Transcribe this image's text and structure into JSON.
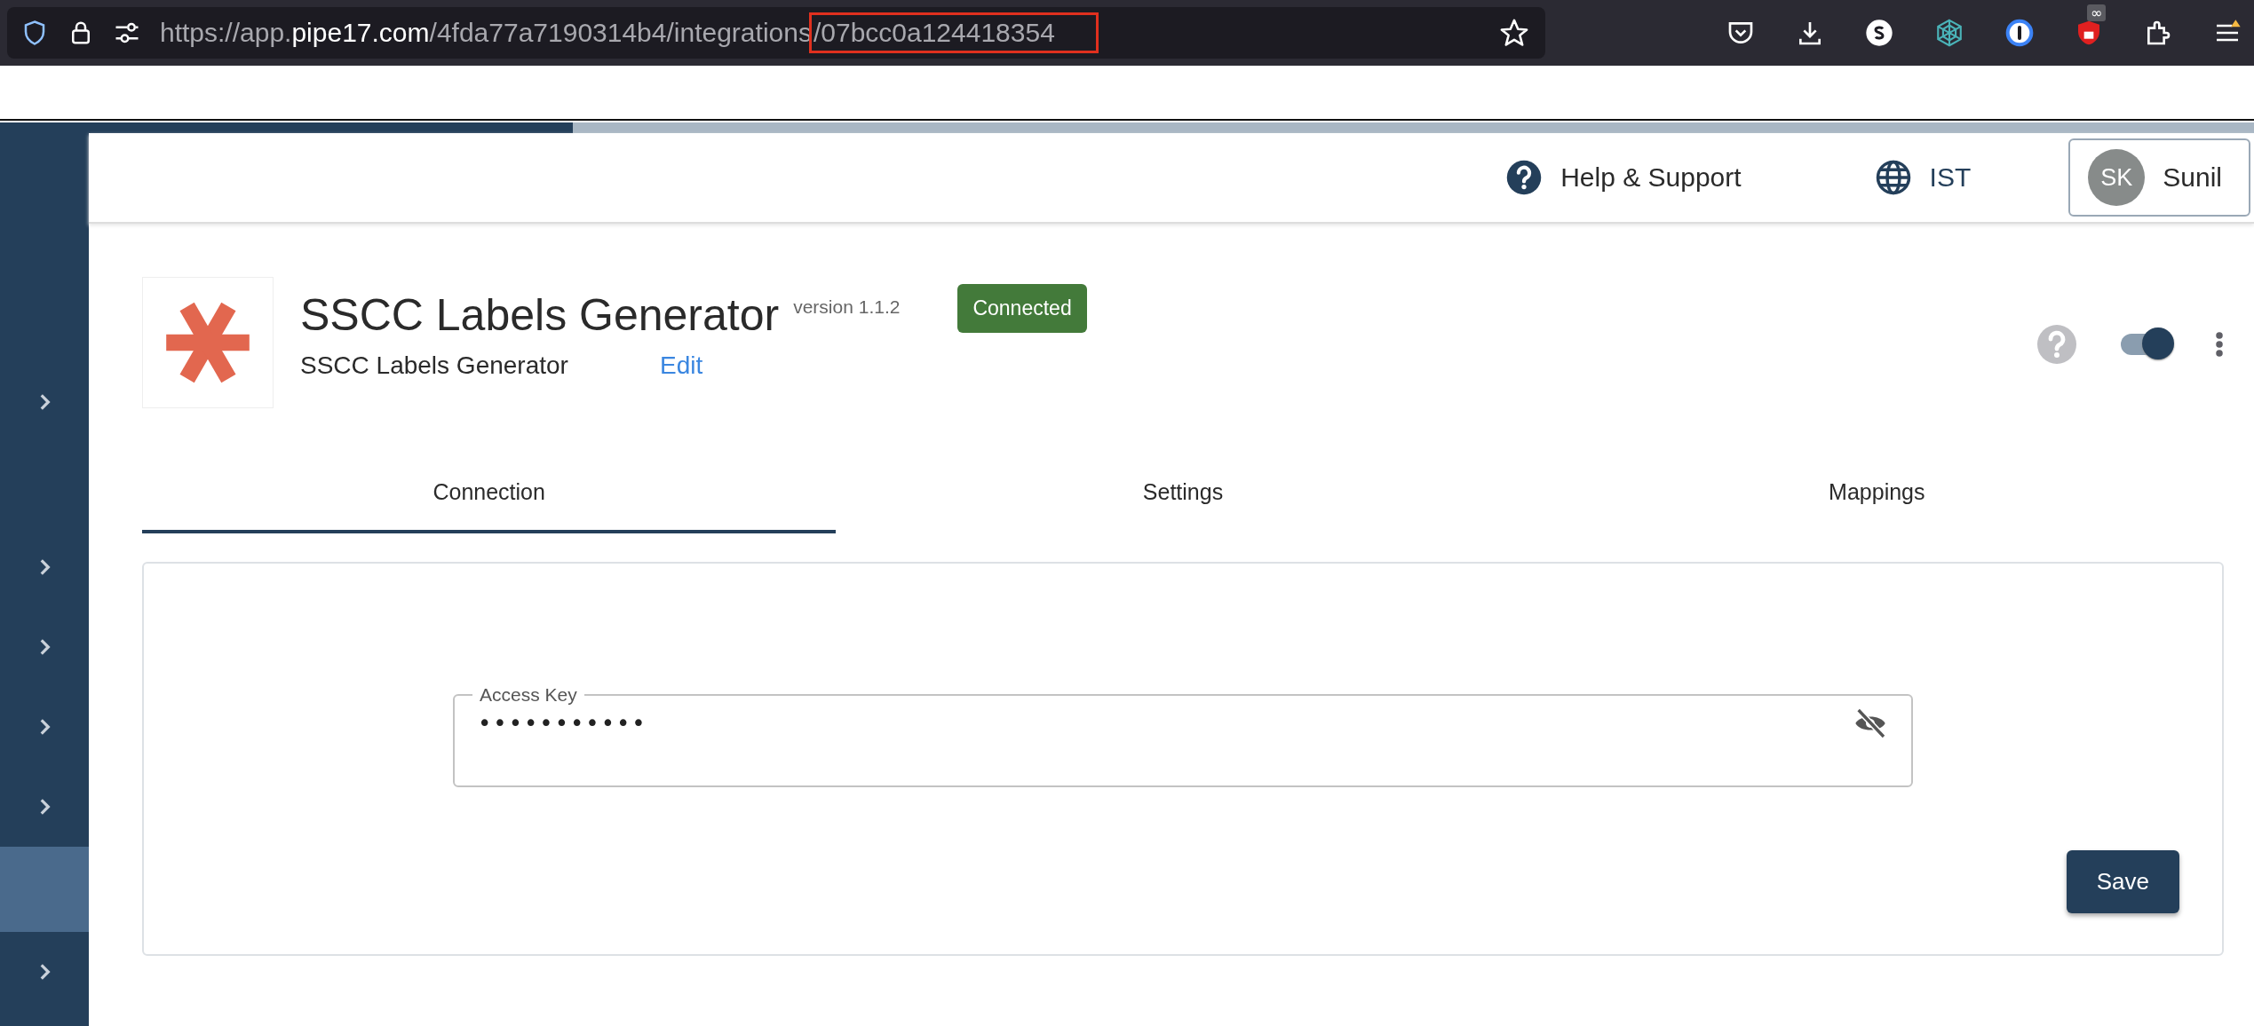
{
  "browser": {
    "url_parts": [
      {
        "text": "https://app.",
        "kind": "dim"
      },
      {
        "text": "pipe17.com",
        "kind": "host"
      },
      {
        "text": "/4fda77a7190314b4/integrations",
        "kind": "dim"
      },
      {
        "text": "/07bcc0a124418354",
        "kind": "marked"
      }
    ],
    "extension_badge": "∞"
  },
  "progress": {
    "level": 0.254
  },
  "sidebar": {
    "items": [
      {
        "expandable": true,
        "selected": false
      },
      {
        "expandable": true,
        "selected": false
      },
      {
        "expandable": true,
        "selected": false
      },
      {
        "expandable": true,
        "selected": false
      },
      {
        "expandable": true,
        "selected": false
      },
      {
        "expandable": false,
        "selected": true
      },
      {
        "expandable": true,
        "selected": false
      }
    ]
  },
  "header": {
    "help": "Help & Support",
    "timezone": "IST",
    "user": {
      "initials": "SK",
      "name": "Sunil"
    }
  },
  "integration": {
    "title": "SSCC Labels Generator",
    "version": "version 1.1.2",
    "status": "Connected",
    "subtitle": "SSCC Labels Generator",
    "edit": "Edit",
    "enabled": true
  },
  "tabs": [
    {
      "label": "Connection",
      "selected": true
    },
    {
      "label": "Settings",
      "selected": false
    },
    {
      "label": "Mappings",
      "selected": false
    }
  ],
  "connection": {
    "field": {
      "label": "Access Key",
      "value": "•••••••••••",
      "masked": true
    },
    "save": "Save"
  }
}
